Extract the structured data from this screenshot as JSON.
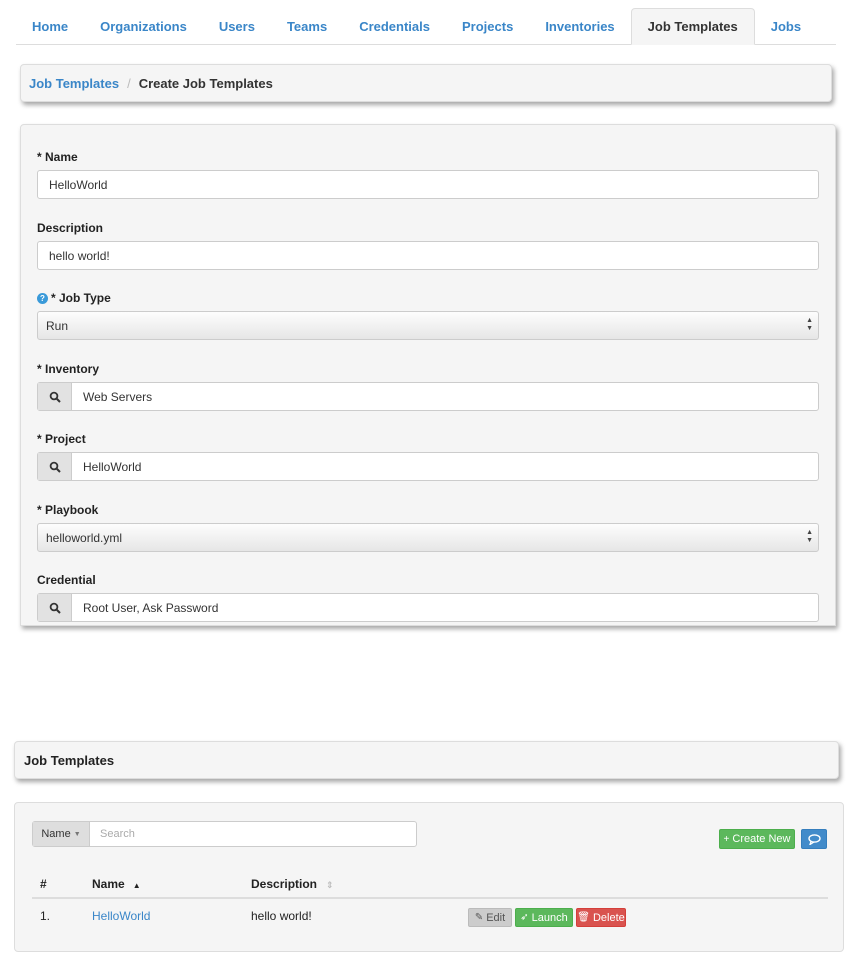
{
  "nav": {
    "tabs": [
      {
        "label": "Home"
      },
      {
        "label": "Organizations"
      },
      {
        "label": "Users"
      },
      {
        "label": "Teams"
      },
      {
        "label": "Credentials"
      },
      {
        "label": "Projects"
      },
      {
        "label": "Inventories"
      },
      {
        "label": "Job Templates",
        "active": true
      },
      {
        "label": "Jobs"
      }
    ]
  },
  "breadcrumb": {
    "parent": "Job Templates",
    "separator": "/",
    "current": "Create Job Templates"
  },
  "form": {
    "name": {
      "label": "* Name",
      "value": "HelloWorld"
    },
    "description": {
      "label": "Description",
      "value": "hello world!"
    },
    "job_type": {
      "label": "* Job Type",
      "value": "Run",
      "help_icon": "question-circle-icon"
    },
    "inventory": {
      "label": "* Inventory",
      "value": "Web Servers",
      "lookup_icon": "search-icon"
    },
    "project": {
      "label": "* Project",
      "value": "HelloWorld",
      "lookup_icon": "search-icon"
    },
    "playbook": {
      "label": "* Playbook",
      "value": "helloworld.yml"
    },
    "credential": {
      "label": "Credential",
      "value": "Root User, Ask Password",
      "lookup_icon": "search-icon"
    }
  },
  "list": {
    "title": "Job Templates",
    "search": {
      "field": "Name",
      "placeholder": "Search"
    },
    "create_new_label": "Create New",
    "columns": {
      "index": "#",
      "name": "Name",
      "description": "Description"
    },
    "rows": [
      {
        "index": "1.",
        "name": "HelloWorld",
        "description": "hello world!"
      }
    ],
    "actions": {
      "edit": "Edit",
      "launch": "Launch",
      "delete": "Delete"
    }
  },
  "colors": {
    "link": "#3a86c8",
    "success": "#5cb85c",
    "danger": "#d9534f",
    "primary": "#428bca",
    "panel_bg": "#f5f5f5"
  }
}
